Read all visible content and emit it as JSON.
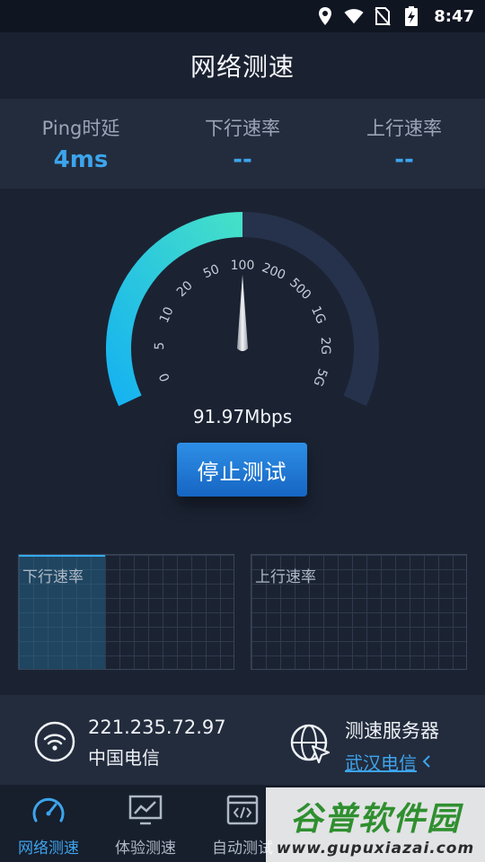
{
  "status_bar": {
    "time": "8:47",
    "icons": [
      "location-icon",
      "wifi-icon",
      "no-sim-icon",
      "battery-charging-icon"
    ]
  },
  "header": {
    "title": "网络测速"
  },
  "stats": [
    {
      "label": "Ping时延",
      "value": "4ms"
    },
    {
      "label": "下行速率",
      "value": "--"
    },
    {
      "label": "上行速率",
      "value": "--"
    }
  ],
  "gauge": {
    "scale_labels": [
      "0",
      "5",
      "10",
      "20",
      "50",
      "100",
      "200",
      "500",
      "1G",
      "2G",
      "5G"
    ],
    "progress_fraction": 0.5,
    "current_speed": "91.97Mbps",
    "colors": {
      "progress_start": "#16b3f0",
      "progress_end": "#45e0c8",
      "track": "#26324b",
      "tick_text": "#c7ccd6"
    }
  },
  "actions": {
    "stop_label": "停止测试"
  },
  "graphs": {
    "download_label": "下行速率",
    "upload_label": "上行速率",
    "download_fill_fraction": 0.4
  },
  "network_info": {
    "ip": "221.235.72.97",
    "isp": "中国电信",
    "server_title": "测速服务器",
    "server_name": "武汉电信"
  },
  "bottom_nav": [
    {
      "label": "网络测速",
      "icon": "speedometer-icon",
      "active": true
    },
    {
      "label": "体验测速",
      "icon": "monitor-chart-icon",
      "active": false
    },
    {
      "label": "自动测试",
      "icon": "code-window-icon",
      "active": false
    }
  ],
  "watermark": {
    "text": "谷普软件园",
    "url": "www.gupuxiazai.com"
  },
  "colors": {
    "accent": "#3da4ec",
    "background": "#1b2333",
    "panel": "#232c3d"
  }
}
